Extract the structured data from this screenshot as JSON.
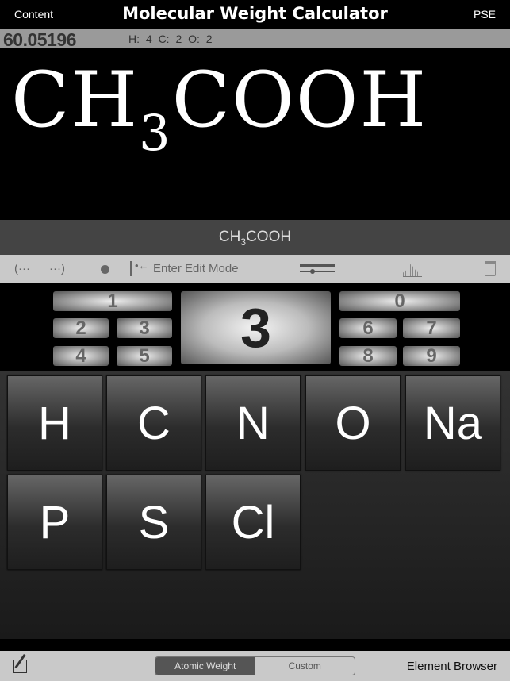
{
  "header": {
    "left_button": "Content",
    "title": "Molecular Weight Calculator",
    "right_button": "PSE"
  },
  "result": {
    "weight": "60.05196",
    "counts": "H: 4  C: 2  O: 2"
  },
  "formula": {
    "parts": [
      "CH",
      "3",
      "COOH"
    ]
  },
  "toolbar": {
    "open_paren": "(···",
    "close_paren": "···)",
    "edit_mode": "Enter Edit Mode",
    "icons": [
      "open-paren-icon",
      "close-paren-icon",
      "dot-icon",
      "cursor-icon",
      "slider-icon",
      "histogram-icon",
      "trash-icon"
    ]
  },
  "numpad": {
    "selected": "3",
    "keys": [
      "1",
      "2",
      "3",
      "4",
      "5",
      "0",
      "6",
      "7",
      "8",
      "9"
    ]
  },
  "elements": [
    "H",
    "C",
    "N",
    "O",
    "Na",
    "P",
    "S",
    "Cl"
  ],
  "bottom": {
    "segments": [
      "Atomic Weight",
      "Custom"
    ],
    "selected": "Atomic Weight",
    "right_button": "Element Browser",
    "left_icon": "edit-icon"
  }
}
